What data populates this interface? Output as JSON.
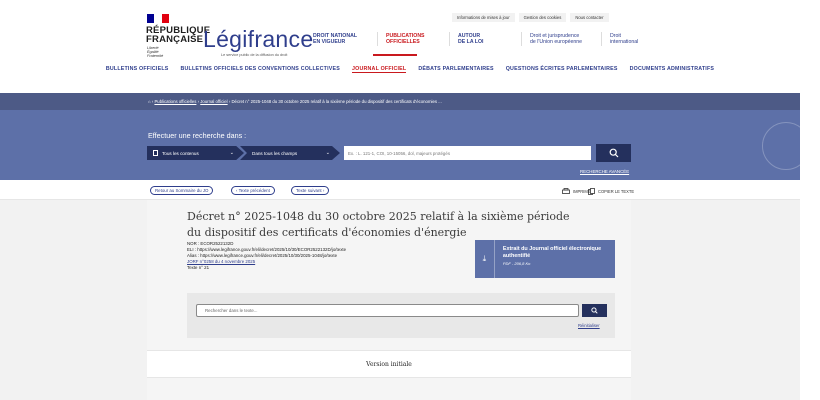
{
  "topbar": {
    "links": [
      "Informations de mises à jour",
      "Gestion des cookies",
      "Nous contacter"
    ]
  },
  "header": {
    "republic": "RÉPUBLIQUE\nFRANÇAISE",
    "motto": "Liberté\nÉgalité\nFraternité",
    "brand": "Légifrance",
    "brand_sub": "Le service public de la diffusion du droit",
    "flag_colors": [
      "#000091",
      "#ffffff",
      "#e1000f"
    ]
  },
  "main_nav": [
    {
      "label": "DROIT NATIONAL\nEN VIGUEUR",
      "active": false
    },
    {
      "label": "PUBLICATIONS\nOFFICIELLES",
      "active": true
    },
    {
      "label": "AUTOUR\nDE LA LOI",
      "active": false
    },
    {
      "label": "Droit et jurisprudence\nde l'Union européenne",
      "active": false
    },
    {
      "label": "Droit\ninternational",
      "active": false
    }
  ],
  "secondary_nav": [
    {
      "label": "BULLETINS OFFICIELS",
      "active": false
    },
    {
      "label": "BULLETINS OFFICIELS DES CONVENTIONS COLLECTIVES",
      "active": false
    },
    {
      "label": "JOURNAL OFFICIEL",
      "active": true
    },
    {
      "label": "DÉBATS PARLEMENTAIRES",
      "active": false
    },
    {
      "label": "QUESTIONS ÉCRITES PARLEMENTAIRES",
      "active": false
    },
    {
      "label": "DOCUMENTS ADMINISTRATIFS",
      "active": false
    }
  ],
  "breadcrumb": {
    "home": "⌂",
    "items": [
      "Publications officielles",
      "Journal officiel",
      "Décret n° 2025-1048 du 30 octobre 2025 relatif à la sixième période du dispositif des certificats d'économies ..."
    ]
  },
  "search": {
    "title": "Effectuer une recherche dans :",
    "scope": "Tous les contenus",
    "field": "Dans tous les champs",
    "placeholder": "Ex. : L. 121-1, COI, 10-15056, dol, majeurs protégés",
    "advanced": "RECHERCHE AVANCÉE"
  },
  "toolbar": {
    "back": "Retour au Sommaire du JO",
    "prev": "‹ Texte précédent",
    "next": "Texte suivant ›",
    "print": "IMPRIMER",
    "copy": "COPIER LE TEXTE"
  },
  "document": {
    "title": "Décret n° 2025-1048 du 30 octobre 2025 relatif à la sixième période du dispositif des certificats d'économies d'énergie",
    "nor": "NOR : ECOR2522132D",
    "eli": "ELI : https://www.legifrance.gouv.fr/eli/decret/2025/10/30/ECOR2522132D/jo/texte",
    "alias": "Alias : https://www.legifrance.gouv.fr/eli/decret/2025/10/30/2025-1048/jo/texte",
    "jorf": "JORF n°0258 du 4 novembre 2025",
    "texte": "Texte n° 21"
  },
  "extract": {
    "label": "Extrait du Journal officiel électronique authentifié",
    "file": "PDF - 206,8 Ko"
  },
  "in_text_search": {
    "placeholder": "Rechercher dans le texte...",
    "reset": "Réinitialiser"
  },
  "version": "Version initiale"
}
